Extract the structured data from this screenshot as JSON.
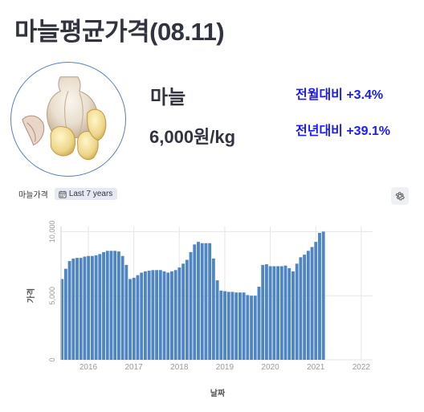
{
  "header": {
    "title": "마늘평균가격(08.11)"
  },
  "product": {
    "name": "마늘",
    "price": "6,000원/kg",
    "change_monthly": "전월대비 +3.4%",
    "change_yearly": "전년대비 +39.1%",
    "image_icon": "garlic-image"
  },
  "chart_header": {
    "label": "마늘가격",
    "range_label": "Last 7 years",
    "calendar_icon": "calendar-icon",
    "settings_icon": "gear-icon"
  },
  "colors": {
    "bar": "#4f86c2",
    "positive_change": "#1a1aff"
  },
  "chart_data": {
    "type": "bar",
    "xlabel": "날짜",
    "ylabel": "가격",
    "x_start": 2015.42,
    "x_step": 0.0833,
    "xlim": [
      2015.4,
      2022.25
    ],
    "ylim": [
      0,
      10400
    ],
    "xticks": [
      2016,
      2017,
      2018,
      2019,
      2020,
      2021,
      2022
    ],
    "xtick_labels": [
      "2016",
      "2017",
      "2018",
      "2019",
      "2020",
      "2021",
      "2022"
    ],
    "yticks": [
      0,
      5000,
      10000
    ],
    "ytick_labels": [
      "0",
      "5,000",
      "10,000"
    ],
    "grid": true,
    "values": [
      6300,
      7100,
      7700,
      7900,
      7950,
      7950,
      8050,
      8100,
      8100,
      8150,
      8250,
      8400,
      8500,
      8500,
      8500,
      8450,
      8100,
      7400,
      6300,
      6400,
      6600,
      6800,
      6900,
      6950,
      7000,
      7000,
      7000,
      6900,
      6800,
      6900,
      7000,
      7200,
      7500,
      7800,
      8400,
      9000,
      9200,
      9100,
      9100,
      9100,
      7900,
      6200,
      5400,
      5350,
      5300,
      5300,
      5250,
      5250,
      5250,
      5050,
      5000,
      5000,
      5700,
      7400,
      7450,
      7300,
      7300,
      7300,
      7300,
      7350,
      7150,
      6900,
      7500,
      8000,
      8200,
      8500,
      8800,
      9200,
      9900,
      10000
    ]
  }
}
